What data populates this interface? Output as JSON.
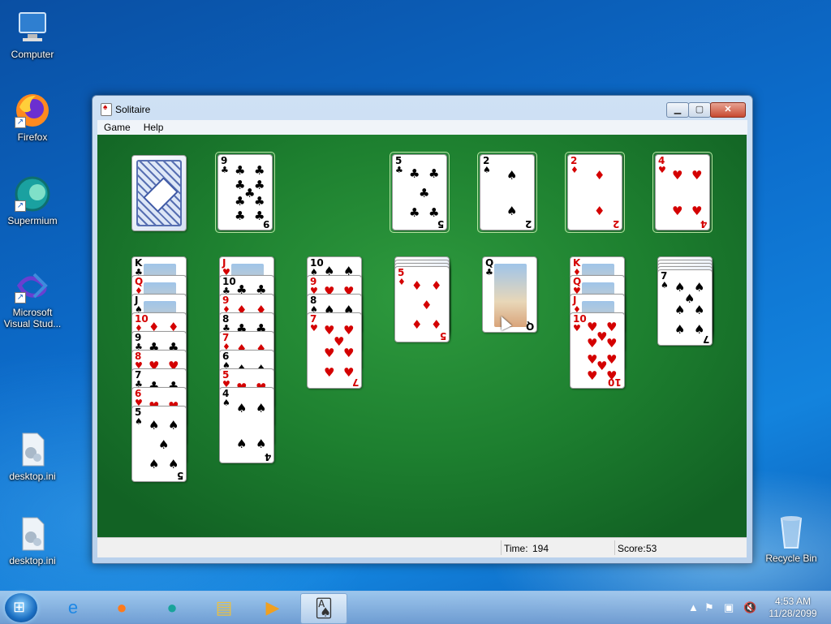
{
  "desktop": {
    "icons": [
      {
        "label": "Computer",
        "icon": "computer-icon"
      },
      {
        "label": "Firefox",
        "icon": "firefox-icon"
      },
      {
        "label": "Supermium",
        "icon": "supermium-icon"
      },
      {
        "label": "Microsoft Visual Stud...",
        "icon": "visual-studio-icon"
      },
      {
        "label": "desktop.ini",
        "icon": "ini-file-icon"
      },
      {
        "label": "desktop.ini",
        "icon": "ini-file-icon"
      },
      {
        "label": "Recycle Bin",
        "icon": "recycle-bin-icon"
      }
    ]
  },
  "window": {
    "title": "Solitaire",
    "menu": [
      "Game",
      "Help"
    ],
    "status": {
      "time_label": "Time:",
      "time_value": "194",
      "score_label": "Score:",
      "score_value": "53"
    }
  },
  "game": {
    "stock": "face-down",
    "waste": {
      "rank": "9",
      "suit": "♣",
      "color": "black"
    },
    "foundations": [
      {
        "rank": "5",
        "suit": "♣",
        "color": "black"
      },
      {
        "rank": "2",
        "suit": "♠",
        "color": "black"
      },
      {
        "rank": "2",
        "suit": "♦",
        "color": "red"
      },
      {
        "rank": "4",
        "suit": "♥",
        "color": "red"
      }
    ],
    "tableau": [
      [
        {
          "rank": "K",
          "suit": "♣",
          "color": "black",
          "art": "face"
        },
        {
          "rank": "Q",
          "suit": "♦",
          "color": "red",
          "art": "face"
        },
        {
          "rank": "J",
          "suit": "♠",
          "color": "black",
          "art": "face"
        },
        {
          "rank": "10",
          "suit": "♦",
          "color": "red"
        },
        {
          "rank": "9",
          "suit": "♣",
          "color": "black"
        },
        {
          "rank": "8",
          "suit": "♥",
          "color": "red"
        },
        {
          "rank": "7",
          "suit": "♣",
          "color": "black"
        },
        {
          "rank": "6",
          "suit": "♥",
          "color": "red"
        },
        {
          "rank": "5",
          "suit": "♠",
          "color": "black"
        }
      ],
      [
        {
          "rank": "J",
          "suit": "♥",
          "color": "red",
          "art": "face"
        },
        {
          "rank": "10",
          "suit": "♣",
          "color": "black"
        },
        {
          "rank": "9",
          "suit": "♦",
          "color": "red"
        },
        {
          "rank": "8",
          "suit": "♣",
          "color": "black"
        },
        {
          "rank": "7",
          "suit": "♦",
          "color": "red"
        },
        {
          "rank": "6",
          "suit": "♠",
          "color": "black"
        },
        {
          "rank": "5",
          "suit": "♥",
          "color": "red"
        },
        {
          "rank": "4",
          "suit": "♠",
          "color": "black"
        }
      ],
      [
        {
          "rank": "10",
          "suit": "♠",
          "color": "black"
        },
        {
          "rank": "9",
          "suit": "♥",
          "color": "red"
        },
        {
          "rank": "8",
          "suit": "♠",
          "color": "black"
        },
        {
          "rank": "7",
          "suit": "♥",
          "color": "red"
        }
      ],
      [
        {
          "rank": "5",
          "suit": "♦",
          "color": "red"
        }
      ],
      [
        {
          "rank": "Q",
          "suit": "♣",
          "color": "black",
          "art": "face"
        }
      ],
      [
        {
          "rank": "K",
          "suit": "♦",
          "color": "red",
          "art": "face"
        },
        {
          "rank": "Q",
          "suit": "♥",
          "color": "red",
          "art": "face"
        },
        {
          "rank": "J",
          "suit": "♦",
          "color": "red",
          "art": "face"
        },
        {
          "rank": "10",
          "suit": "♥",
          "color": "red"
        }
      ],
      [
        {
          "rank": "7",
          "suit": "♠",
          "color": "black"
        }
      ]
    ],
    "tableau_hidden": [
      0,
      0,
      0,
      3,
      0,
      0,
      4
    ]
  },
  "taskbar": {
    "items": [
      {
        "icon": "internet-explorer-icon",
        "glyph": "e"
      },
      {
        "icon": "firefox-icon",
        "glyph": "●"
      },
      {
        "icon": "supermium-icon",
        "glyph": "●"
      },
      {
        "icon": "file-explorer-icon",
        "glyph": "▤"
      },
      {
        "icon": "media-player-icon",
        "glyph": "▶"
      },
      {
        "icon": "solitaire-icon",
        "glyph": "🂡"
      }
    ],
    "clock_time": "4:53 AM",
    "clock_date": "11/28/2099"
  }
}
